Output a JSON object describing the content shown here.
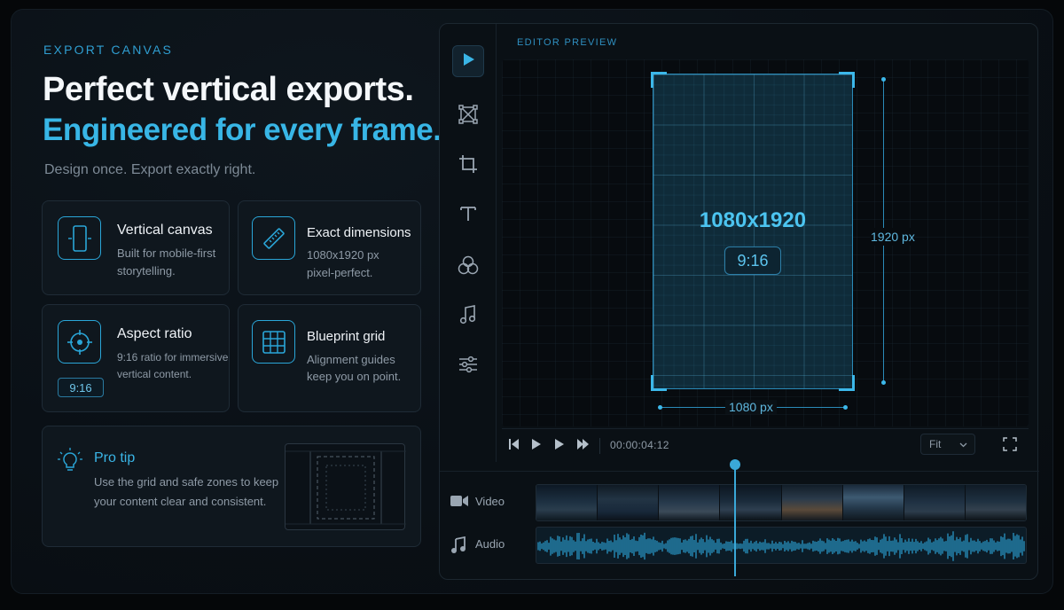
{
  "hero": {
    "eyebrow": "EXPORT CANVAS",
    "title_line1": "Perfect vertical exports.",
    "title_line2": "Engineered for every frame.",
    "subtitle": "Design once. Export exactly right."
  },
  "features": [
    {
      "title": "Vertical canvas",
      "desc_line1": "Built for mobile-first",
      "desc_line2": "storytelling.",
      "icon": "phone-icon"
    },
    {
      "title": "Exact dimensions",
      "desc_line1": "1080x1920 px",
      "desc_line2": "pixel-perfect.",
      "icon": "ruler-icon"
    },
    {
      "title": "Aspect ratio",
      "desc_line1": "9:16 ratio for immersive",
      "desc_line2": "vertical content.",
      "badge": "9:16",
      "icon": "crosshair-icon"
    },
    {
      "title": "Blueprint grid",
      "desc_line1": "Alignment guides",
      "desc_line2": "keep you on point.",
      "icon": "grid-icon"
    }
  ],
  "tip": {
    "title": "Pro tip",
    "desc": "Use the grid and safe zones to keep your content clear and consistent.",
    "icon": "lightbulb-icon"
  },
  "editor": {
    "label": "EDITOR PREVIEW",
    "tools": [
      "play-icon",
      "transform-icon",
      "crop-icon",
      "text-icon",
      "color-icon",
      "music-icon",
      "adjust-icon"
    ],
    "canvas_dims": "1080x1920",
    "canvas_ratio": "9:16",
    "height_label": "1920 px",
    "width_label": "1080 px",
    "timecode": "00:00:04:12",
    "zoom": "Fit",
    "tracks": [
      {
        "label": "Video",
        "icon": "video-camera-icon"
      },
      {
        "label": "Audio",
        "icon": "music-note-icon"
      }
    ],
    "accent": "#38b6e6"
  }
}
